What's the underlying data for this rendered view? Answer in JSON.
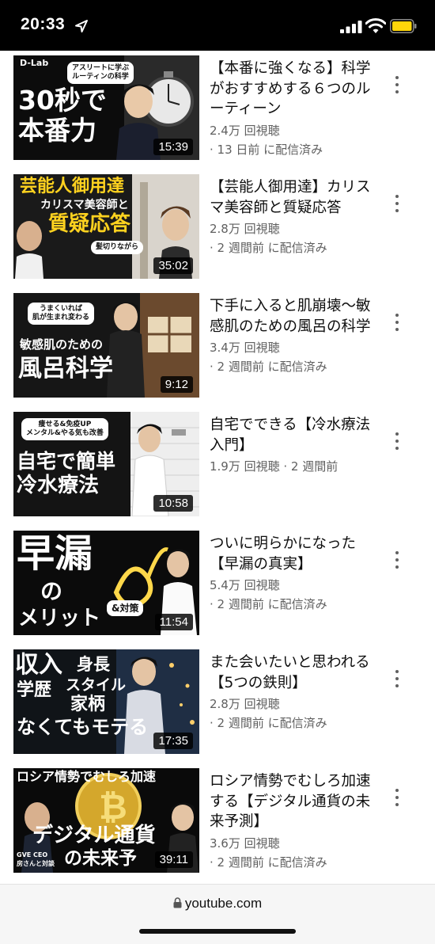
{
  "status_bar": {
    "time": "20:33"
  },
  "videos": [
    {
      "title": "【本番に強くなる】科学がおすすめする６つのルーティーン",
      "views": "2.4万 回視聴",
      "published": "· 13 日前 に配信済み",
      "duration": "15:39",
      "thumb_text": {
        "logo": "D-Lab",
        "bubble": "アスリートに学ぶ\nルーティンの科学",
        "line1": "30秒で",
        "line2": "本番力"
      }
    },
    {
      "title": "【芸能人御用達】カリスマ美容師と質疑応答",
      "views": "2.8万 回視聴",
      "published": "· 2 週間前 に配信済み",
      "duration": "35:02",
      "thumb_text": {
        "line1": "芸能人御用達",
        "line2": "カリスマ美容師と",
        "line3": "質疑応答",
        "bubble": "髪切りながら"
      }
    },
    {
      "title": "下手に入ると肌崩壊〜敏感肌のための風呂の科学",
      "views": "3.4万 回視聴",
      "published": "· 2 週間前 に配信済み",
      "duration": "9:12",
      "thumb_text": {
        "bubble": "うまくいれば\n肌が生まれ変わる",
        "line1": "敏感肌のための",
        "line2": "風呂科学"
      }
    },
    {
      "title": "自宅でできる【冷水療法入門】",
      "views_published": "1.9万 回視聴 · 2 週間前",
      "duration": "10:58",
      "thumb_text": {
        "bubble": "痩せる&免疫UP\nメンタル&やる気も改善",
        "line1": "自宅で簡単",
        "line2": "冷水療法"
      }
    },
    {
      "title": "ついに明らかになった【早漏の真実】",
      "views": "5.4万 回視聴",
      "published": "· 2 週間前 に配信済み",
      "duration": "11:54",
      "thumb_text": {
        "line1": "早漏",
        "line2": "の",
        "line3": "メリット",
        "bubble": "&対策"
      }
    },
    {
      "title": "また会いたいと思われる【5つの鉄則】",
      "views": "2.8万 回視聴",
      "published": "· 2 週間前 に配信済み",
      "duration": "17:35",
      "thumb_text": {
        "line1": "収入",
        "line2": "身長",
        "line3": "学歴",
        "line4": "スタイル",
        "line5": "家柄",
        "line6": "なくてもモテる"
      }
    },
    {
      "title": "ロシア情勢でむしろ加速する【デジタル通貨の未来予測】",
      "views": "3.6万 回視聴",
      "published": "· 2 週間前 に配信済み",
      "duration": "39:11",
      "thumb_text": {
        "line1": "ロシア情勢でむしろ加速",
        "line2": "デジタル通貨",
        "line3": "の未来予",
        "caption1": "GVE CEO",
        "caption2": "房さんと対談"
      }
    }
  ],
  "browser": {
    "url": "youtube.com"
  },
  "colors": {
    "status_bar_bg": "#000000",
    "meta_text": "#606060",
    "battery": "#ffd60a"
  }
}
